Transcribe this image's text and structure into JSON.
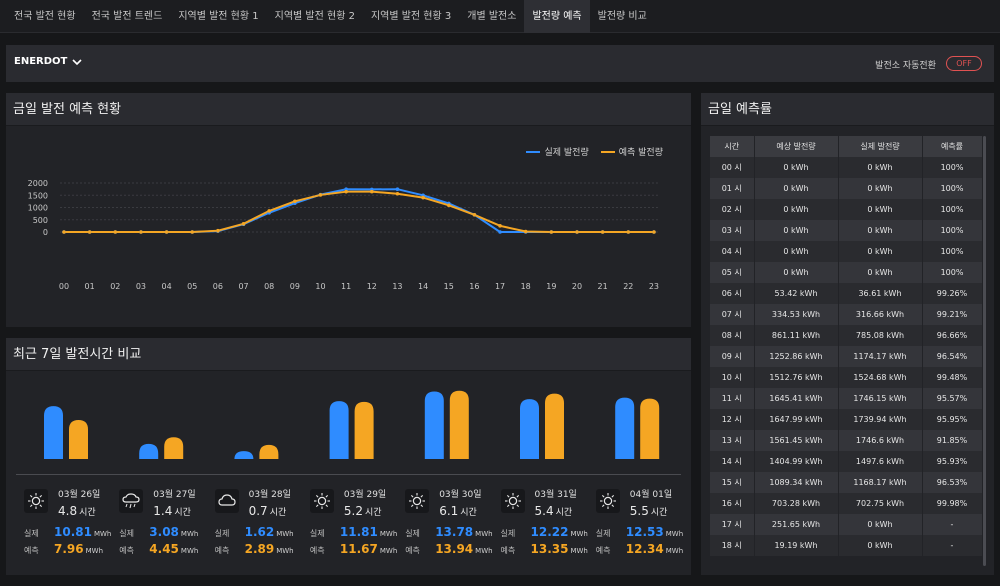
{
  "tabs": [
    {
      "label": "전국 발전 현황",
      "active": false
    },
    {
      "label": "전국 발전 트렌드",
      "active": false
    },
    {
      "label": "지역별 발전 현황 1",
      "active": false
    },
    {
      "label": "지역별 발전 현황 2",
      "active": false
    },
    {
      "label": "지역별 발전 현황 3",
      "active": false
    },
    {
      "label": "개별 발전소",
      "active": false
    },
    {
      "label": "발전량 예측",
      "active": true
    },
    {
      "label": "발전량 비교",
      "active": false
    }
  ],
  "topbar": {
    "brand": "ENERDOT",
    "switch_label": "발전소 자동전환",
    "toggle_label": "OFF"
  },
  "forecast_panel": {
    "title": "금일 발전 예측 현황"
  },
  "compare_panel": {
    "title": "최근 7일 발전시간 비교"
  },
  "rate_panel": {
    "title": "금일 예측률"
  },
  "colors": {
    "actual": "#2f8cff",
    "predicted": "#f5a623",
    "off_toggle": "#e05252"
  },
  "chart_data": [
    {
      "type": "line",
      "x": [
        "00",
        "01",
        "02",
        "03",
        "04",
        "05",
        "06",
        "07",
        "08",
        "09",
        "10",
        "11",
        "12",
        "13",
        "14",
        "15",
        "16",
        "17",
        "18",
        "19",
        "20",
        "21",
        "22",
        "23"
      ],
      "series": [
        {
          "name": "실제 발전량",
          "color": "#2f8cff",
          "values": [
            0,
            0,
            0,
            0,
            0,
            0,
            36.61,
            316.66,
            785.08,
            1174.17,
            1524.68,
            1746.15,
            1739.94,
            1746.6,
            1497.6,
            1168.17,
            702.75,
            0,
            0,
            0,
            0,
            0,
            0,
            0
          ]
        },
        {
          "name": "예측 발전량",
          "color": "#f5a623",
          "values": [
            0,
            0,
            0,
            0,
            0,
            0,
            53.42,
            334.53,
            861.11,
            1252.86,
            1512.76,
            1645.41,
            1647.99,
            1561.45,
            1404.99,
            1089.34,
            703.28,
            251.65,
            19.19,
            0,
            0,
            0,
            0,
            0
          ]
        }
      ],
      "yticks": [
        0,
        500,
        1000,
        1500,
        2000
      ],
      "ylim": [
        0,
        2000
      ],
      "legend": "top-right",
      "grid": true
    },
    {
      "type": "bar",
      "categories": [
        "03월 26일",
        "03월 27일",
        "03월 28일",
        "03월 29일",
        "03월 30일",
        "03월 31일",
        "04월 01일"
      ],
      "series": [
        {
          "name": "실제",
          "color": "#2f8cff",
          "values": [
            10.81,
            3.08,
            1.62,
            11.81,
            13.78,
            12.22,
            12.53
          ]
        },
        {
          "name": "예측",
          "color": "#f5a623",
          "values": [
            7.96,
            4.45,
            2.89,
            11.67,
            13.94,
            13.35,
            12.34
          ]
        }
      ]
    }
  ],
  "days": [
    {
      "date": "03월 26일",
      "hours": "4.8",
      "hours_unit": "시간",
      "weather_icon": "sun-icon",
      "actual_label": "실제",
      "actual": "10.81",
      "pred_label": "예측",
      "pred": "7.96",
      "unit": "MWh"
    },
    {
      "date": "03월 27일",
      "hours": "1.4",
      "hours_unit": "시간",
      "weather_icon": "rain-cloud-icon",
      "actual_label": "실제",
      "actual": "3.08",
      "pred_label": "예측",
      "pred": "4.45",
      "unit": "MWh"
    },
    {
      "date": "03월 28일",
      "hours": "0.7",
      "hours_unit": "시간",
      "weather_icon": "cloud-icon",
      "actual_label": "실제",
      "actual": "1.62",
      "pred_label": "예측",
      "pred": "2.89",
      "unit": "MWh"
    },
    {
      "date": "03월 29일",
      "hours": "5.2",
      "hours_unit": "시간",
      "weather_icon": "sun-icon",
      "actual_label": "실제",
      "actual": "11.81",
      "pred_label": "예측",
      "pred": "11.67",
      "unit": "MWh"
    },
    {
      "date": "03월 30일",
      "hours": "6.1",
      "hours_unit": "시간",
      "weather_icon": "sun-icon",
      "actual_label": "실제",
      "actual": "13.78",
      "pred_label": "예측",
      "pred": "13.94",
      "unit": "MWh"
    },
    {
      "date": "03월 31일",
      "hours": "5.4",
      "hours_unit": "시간",
      "weather_icon": "sun-icon",
      "actual_label": "실제",
      "actual": "12.22",
      "pred_label": "예측",
      "pred": "13.35",
      "unit": "MWh"
    },
    {
      "date": "04월 01일",
      "hours": "5.5",
      "hours_unit": "시간",
      "weather_icon": "sun-icon",
      "actual_label": "실제",
      "actual": "12.53",
      "pred_label": "예측",
      "pred": "12.34",
      "unit": "MWh"
    }
  ],
  "rate_table": {
    "headers": [
      "시간",
      "예상 발전량",
      "실제 발전량",
      "예측률"
    ],
    "rows": [
      [
        "00 시",
        "0 kWh",
        "0 kWh",
        "100%"
      ],
      [
        "01 시",
        "0 kWh",
        "0 kWh",
        "100%"
      ],
      [
        "02 시",
        "0 kWh",
        "0 kWh",
        "100%"
      ],
      [
        "03 시",
        "0 kWh",
        "0 kWh",
        "100%"
      ],
      [
        "04 시",
        "0 kWh",
        "0 kWh",
        "100%"
      ],
      [
        "05 시",
        "0 kWh",
        "0 kWh",
        "100%"
      ],
      [
        "06 시",
        "53.42 kWh",
        "36.61 kWh",
        "99.26%"
      ],
      [
        "07 시",
        "334.53 kWh",
        "316.66 kWh",
        "99.21%"
      ],
      [
        "08 시",
        "861.11 kWh",
        "785.08 kWh",
        "96.66%"
      ],
      [
        "09 시",
        "1252.86 kWh",
        "1174.17 kWh",
        "96.54%"
      ],
      [
        "10 시",
        "1512.76 kWh",
        "1524.68 kWh",
        "99.48%"
      ],
      [
        "11 시",
        "1645.41 kWh",
        "1746.15 kWh",
        "95.57%"
      ],
      [
        "12 시",
        "1647.99 kWh",
        "1739.94 kWh",
        "95.95%"
      ],
      [
        "13 시",
        "1561.45 kWh",
        "1746.6 kWh",
        "91.85%"
      ],
      [
        "14 시",
        "1404.99 kWh",
        "1497.6 kWh",
        "95.93%"
      ],
      [
        "15 시",
        "1089.34 kWh",
        "1168.17 kWh",
        "96.53%"
      ],
      [
        "16 시",
        "703.28 kWh",
        "702.75 kWh",
        "99.98%"
      ],
      [
        "17 시",
        "251.65 kWh",
        "0 kWh",
        "-"
      ],
      [
        "18 시",
        "19.19 kWh",
        "0 kWh",
        "-"
      ]
    ]
  }
}
